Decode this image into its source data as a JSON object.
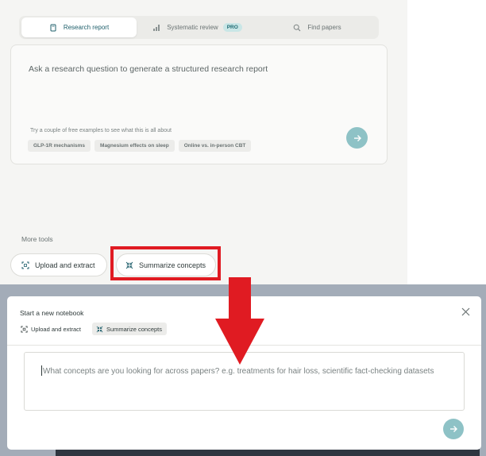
{
  "tabs": [
    {
      "label": "Research report",
      "icon": "notebook-icon",
      "active": true
    },
    {
      "label": "Systematic review",
      "icon": "review-icon",
      "badge": "PRO",
      "active": false
    },
    {
      "label": "Find papers",
      "icon": "search-icon",
      "active": false
    }
  ],
  "query": {
    "placeholder": "Ask a research question to generate a structured research report",
    "examples_hint": "Try a couple of free examples to see what this is all about",
    "examples": [
      "GLP-1R mechanisms",
      "Magnesium effects on sleep",
      "Online vs. in-person CBT"
    ]
  },
  "more_tools": {
    "label": "More tools",
    "upload_label": "Upload and extract",
    "summarize_label": "Summarize concepts"
  },
  "dialog": {
    "title": "Start a new notebook",
    "upload_label": "Upload and extract",
    "summarize_label": "Summarize concepts",
    "input_placeholder": "What concepts are you looking for across papers? e.g. treatments for hair loss, scientific fact-checking datasets"
  },
  "colors": {
    "accent": "#8ec2c6",
    "highlight": "#e01b22",
    "panel_bg": "#f5f5f3",
    "overlay": "#a3acb8"
  }
}
